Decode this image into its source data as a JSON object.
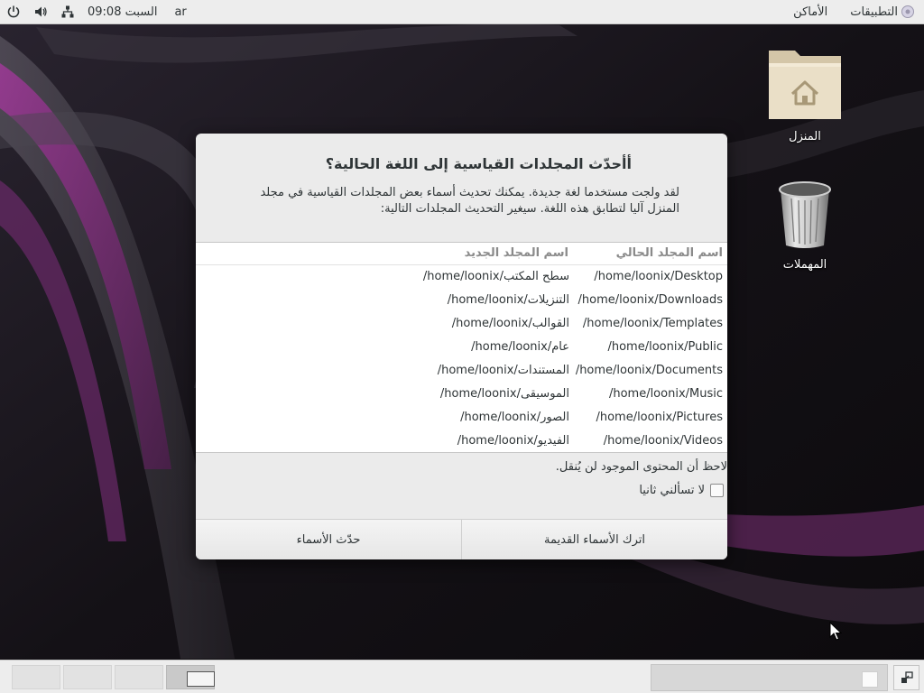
{
  "top_panel": {
    "applications_label": "التطبيقات",
    "places_label": "الأماكن",
    "keyboard_layout": "ar",
    "clock": "السبت 09:08",
    "icons": [
      "power-icon",
      "volume-icon",
      "network-icon",
      "applications-menu-icon"
    ]
  },
  "desktop": {
    "icons": [
      {
        "label": "المنزل",
        "icon": "home-folder-icon"
      },
      {
        "label": "المهملات",
        "icon": "trash-icon"
      }
    ]
  },
  "dialog": {
    "title": "أأحدّث المجلدات القياسية إلى اللغة الحالية؟",
    "description": "لقد ولجت مستخدما لغة جديدة. يمكنك تحديث أسماء بعض المجلدات القياسية في مجلد المنزل آليا لتطابق هذه اللغة. سيغير التحديث المجلدات التالية:",
    "columns": {
      "current": "اسم المجلد الحالي",
      "new": "اسم المجلد الجديد"
    },
    "rows": [
      {
        "current": "/home/loonix/Desktop",
        "new": "/home/loonix/سطح المكتب"
      },
      {
        "current": "/home/loonix/Downloads",
        "new": "/home/loonix/التنزيلات"
      },
      {
        "current": "/home/loonix/Templates",
        "new": "/home/loonix/القوالب"
      },
      {
        "current": "/home/loonix/Public",
        "new": "/home/loonix/عام"
      },
      {
        "current": "/home/loonix/Documents",
        "new": "/home/loonix/المستندات"
      },
      {
        "current": "/home/loonix/Music",
        "new": "/home/loonix/الموسيقى"
      },
      {
        "current": "/home/loonix/Pictures",
        "new": "/home/loonix/الصور"
      },
      {
        "current": "/home/loonix/Videos",
        "new": "/home/loonix/الفيديو"
      }
    ],
    "note": "لاحظ أن المحتوى الموجود لن يُنقل.",
    "dont_ask_label": "لا تسألني ثانيا",
    "dont_ask_checked": false,
    "keep_button": "اترك الأسماء القديمة",
    "update_button": "حدّث الأسماء"
  },
  "bottom_panel": {
    "workspaces": 4,
    "active_workspace": 4,
    "icons": [
      "show-desktop-icon"
    ]
  },
  "colors": {
    "panel_bg": "#ededed",
    "dialog_bg": "#ebebeb",
    "wallpaper_base": "#151217",
    "wallpaper_accent": "#7a2a78"
  }
}
